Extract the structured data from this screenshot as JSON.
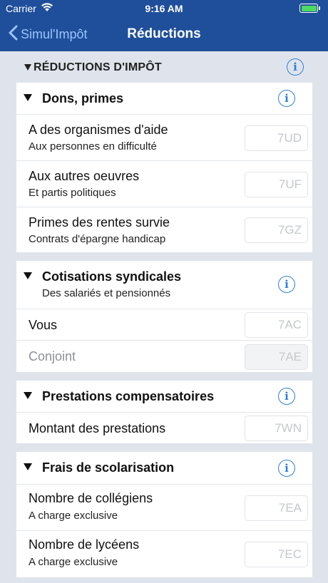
{
  "status_bar": {
    "carrier": "Carrier",
    "time": "9:16 AM"
  },
  "nav": {
    "back_label": "Simul'Impôt",
    "title": "Réductions"
  },
  "section": {
    "title": "RÉDUCTIONS D'IMPÔT",
    "info": "i"
  },
  "groups": [
    {
      "title": "Dons, primes",
      "subtitle": "",
      "info": "i",
      "rows": [
        {
          "label": "A des organismes d'aide",
          "sublabel": "Aux personnes en difficulté",
          "code": "7UD"
        },
        {
          "label": "Aux autres oeuvres",
          "sublabel": "Et partis politiques",
          "code": "7UF"
        },
        {
          "label": "Primes des rentes survie",
          "sublabel": "Contrats d'épargne handicap",
          "code": "7GZ"
        }
      ]
    },
    {
      "title": "Cotisations syndicales",
      "subtitle": "Des salariés et pensionnés",
      "info": "i",
      "rows": [
        {
          "label": "Vous",
          "sublabel": "",
          "code": "7AC"
        },
        {
          "label": "Conjoint",
          "sublabel": "",
          "code": "7AE",
          "disabled": true
        }
      ]
    },
    {
      "title": "Prestations compensatoires",
      "subtitle": "",
      "info": "i",
      "rows": [
        {
          "label": "Montant des prestations",
          "sublabel": "",
          "code": "7WN"
        }
      ]
    },
    {
      "title": "Frais de scolarisation",
      "subtitle": "",
      "info": "i",
      "rows": [
        {
          "label": "Nombre de collégiens",
          "sublabel": "A charge exclusive",
          "code": "7EA"
        },
        {
          "label": "Nombre de lycéens",
          "sublabel": "A charge exclusive",
          "code": "7EC"
        }
      ]
    }
  ],
  "colors": {
    "nav_bg": "#1f4f9a",
    "accent": "#2f7fd6",
    "page_bg": "#dfe4ec"
  }
}
